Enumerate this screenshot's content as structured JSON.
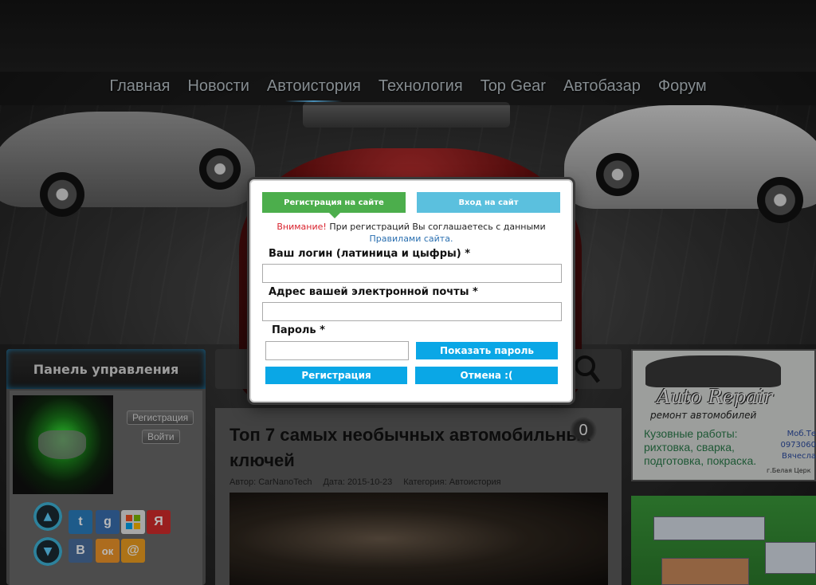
{
  "nav": {
    "items": [
      {
        "label": "Главная"
      },
      {
        "label": "Новости"
      },
      {
        "label": "Автоистория",
        "active": true
      },
      {
        "label": "Технология"
      },
      {
        "label": "Top Gear"
      },
      {
        "label": "Автобазар"
      },
      {
        "label": "Форум"
      }
    ]
  },
  "panel": {
    "title": "Панель управления",
    "register_label": "Регистрация",
    "login_label": "Войти",
    "social": [
      {
        "icon": "twitter-icon",
        "glyph": "🐦",
        "color": "#2a7fc0"
      },
      {
        "icon": "google-icon",
        "glyph": "g",
        "color": "#3a6fb0"
      },
      {
        "icon": "windows-icon",
        "glyph": "⊞",
        "color": "#e8e8e8"
      },
      {
        "icon": "yandex-icon",
        "glyph": "Я",
        "color": "#d62b2b"
      },
      {
        "icon": "vk-icon",
        "glyph": "В",
        "color": "#4a6fa0"
      },
      {
        "icon": "odnoklassniki-icon",
        "glyph": "ок",
        "color": "#f0962a"
      },
      {
        "icon": "mail-icon",
        "glyph": "@",
        "color": "#f0a020"
      }
    ]
  },
  "article": {
    "title": "Топ 7 самых необычных автомобильных ключей",
    "author": "Автор: CarNanoTech",
    "date": "Дата: 2015-10-23",
    "category": "Категория: Автоистория",
    "comments": "0"
  },
  "ads": {
    "logo": "Auto Repair",
    "subtitle": "ремонт автомобилей",
    "services": "Кузовные работы: рихтовка, сварка, подготовка, покраска.",
    "phone_label": "Моб.Те",
    "phone": "0973060",
    "name": "Вячесла",
    "city": "г.Белая Церк"
  },
  "modal": {
    "tab_register": "Регистрация на сайте",
    "tab_login": "Вход на сайт",
    "notice_warn": "Внимание!",
    "notice_text": "При регистраций Вы соглашаетесь с данными",
    "notice_rules": "Правилами сайта.",
    "login_label": "Ваш логин (латиница и цыфры) *",
    "login_value": "",
    "email_label": "Адрес вашей электронной почты *",
    "email_value": "",
    "password_label": "Пароль *",
    "password_value": "",
    "show_password": "Показать пароль",
    "submit": "Регистрация",
    "cancel": "Отмена :("
  },
  "colors": {
    "accent_green": "#4cae4c",
    "accent_blue": "#5bc0de",
    "button_blue": "#0aa7e6",
    "warning_red": "#d9232e"
  }
}
